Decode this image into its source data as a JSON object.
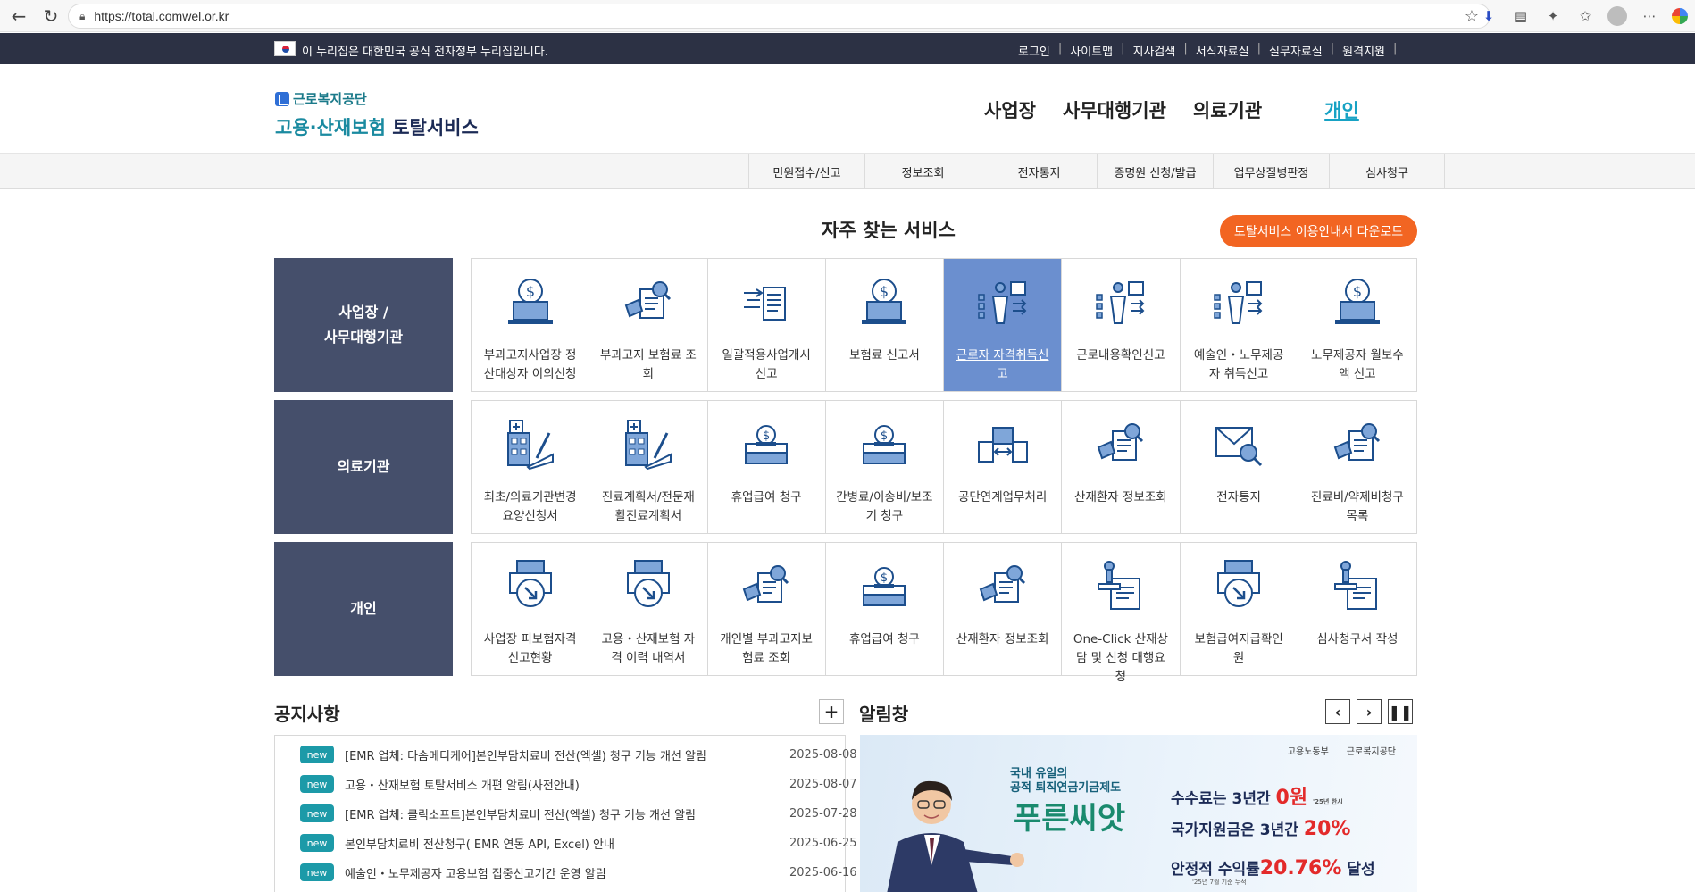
{
  "browser": {
    "url": "https://total.comwel.or.kr",
    "back_icon": "arrow-left-icon",
    "reload_icon": "reload-icon"
  },
  "gov_bar": {
    "notice": "이 누리집은 대한민국 공식 전자정부 누리집입니다.",
    "links": [
      "로그인",
      "사이트맵",
      "지사검색",
      "서식자료실",
      "실무자료실",
      "원격지원"
    ]
  },
  "header": {
    "logo_org": "근로복지공단",
    "logo_service_a": "고용·산재보험",
    "logo_service_b": "토탈서비스",
    "nav": [
      "사업장",
      "사무대행기관",
      "의료기관",
      "개인"
    ],
    "active_nav": "개인"
  },
  "sub_nav": [
    "민원접수/신고",
    "정보조회",
    "전자통지",
    "증명원 신청/발급",
    "업무상질병판정",
    "심사청구"
  ],
  "frequent": {
    "title": "자주 찾는 서비스",
    "guide_button": "토탈서비스 이용안내서 다운로드",
    "rows": [
      {
        "head_line1": "사업장 /",
        "head_line2": "사무대행기관",
        "items": [
          {
            "label": "부과고지사업장 정산대상자 이의신청",
            "icon": "money-laptop-icon"
          },
          {
            "label": "부과고지 보험료 조회",
            "icon": "document-search-icon"
          },
          {
            "label": "일괄적용사업개시신고",
            "icon": "documents-arrow-icon"
          },
          {
            "label": "보험료 신고서",
            "icon": "money-laptop-icon"
          },
          {
            "label": "근로자 자격취득신고",
            "icon": "worker-chart-icon",
            "selected": true
          },
          {
            "label": "근로내용확인신고",
            "icon": "worker-chart-icon"
          },
          {
            "label": "예술인・노무제공자 취득신고",
            "icon": "worker-chart-icon"
          },
          {
            "label": "노무제공자 월보수액 신고",
            "icon": "money-laptop-icon"
          }
        ]
      },
      {
        "head_line1": "의료기관",
        "head_line2": "",
        "items": [
          {
            "label": "최초/의료기관변경요양신청서",
            "icon": "hospital-pen-icon"
          },
          {
            "label": "진료계획서/전문재활진료계획서",
            "icon": "hospital-pen-icon"
          },
          {
            "label": "휴업급여 청구",
            "icon": "money-box-icon"
          },
          {
            "label": "간병료/이송비/보조기 청구",
            "icon": "money-box-icon"
          },
          {
            "label": "공단연계업무처리",
            "icon": "exchange-icon"
          },
          {
            "label": "산재환자 정보조회",
            "icon": "document-search-icon"
          },
          {
            "label": "전자통지",
            "icon": "mail-search-icon"
          },
          {
            "label": "진료비/약제비청구목록",
            "icon": "document-search-icon"
          }
        ]
      },
      {
        "head_line1": "개인",
        "head_line2": "",
        "items": [
          {
            "label": "사업장 피보험자격 신고현황",
            "icon": "printer-arrow-icon"
          },
          {
            "label": "고용・산재보험 자격 이력 내역서",
            "icon": "printer-arrow-icon"
          },
          {
            "label": "개인별 부과고지보험료 조회",
            "icon": "document-search-icon"
          },
          {
            "label": "휴업급여 청구",
            "icon": "money-box-icon"
          },
          {
            "label": "산재환자 정보조회",
            "icon": "document-search-icon"
          },
          {
            "label": "One-Click 산재상담 및 신청 대행요청",
            "icon": "stamp-document-icon"
          },
          {
            "label": "보험급여지급확인원",
            "icon": "printer-arrow-icon"
          },
          {
            "label": "심사청구서 작성",
            "icon": "stamp-document-icon"
          }
        ]
      }
    ]
  },
  "notices": {
    "title": "공지사항",
    "more_label": "+",
    "badge": "new",
    "items": [
      {
        "title": "[EMR 업체: 다솜메디케어]본인부담치료비 전산(엑셀) 청구 기능 개선 알림",
        "date": "2025-08-08"
      },
      {
        "title": "고용・산재보험 토탈서비스 개편 알림(사전안내)",
        "date": "2025-08-07"
      },
      {
        "title": "[EMR 업체: 클릭소프트]본인부담치료비 전산(엑셀) 청구 기능 개선 알림",
        "date": "2025-07-28"
      },
      {
        "title": "본인부담치료비 전산청구( EMR 연동 API, Excel) 안내",
        "date": "2025-06-25"
      },
      {
        "title": "예술인・노무제공자 고용보험 집중신고기간 운영 알림",
        "date": "2025-06-16"
      }
    ]
  },
  "alerts": {
    "title": "알림창",
    "prev_icon": "chevron-left-icon",
    "next_icon": "chevron-right-icon",
    "pause_icon": "pause-icon",
    "banner": {
      "org1": "고용노동부",
      "org2": "근로복지공단",
      "sub_line1": "국내 유일의",
      "sub_line2": "공적 퇴직연금기금제도",
      "brand": "푸른씨앗",
      "line1_a": "수수료는 ",
      "line1_b": "3년간 ",
      "line1_c": "0원",
      "line1_note": "'25년 한시",
      "line2_a": "국가지원금은 ",
      "line2_b": "3년간 ",
      "line2_c": "20%",
      "line3_a": "안정적 수익률",
      "line3_b": "20.76%",
      "line3_c": " 달성",
      "line3_note": "'25년 7월 기준 누적"
    }
  },
  "colors": {
    "gov_bar": "#2c3144",
    "row_head": "#454f6b",
    "selected": "#6b8fcf",
    "accent_orange": "#f26522",
    "badge": "#1c9aa8",
    "active_nav": "#17a2c4"
  }
}
